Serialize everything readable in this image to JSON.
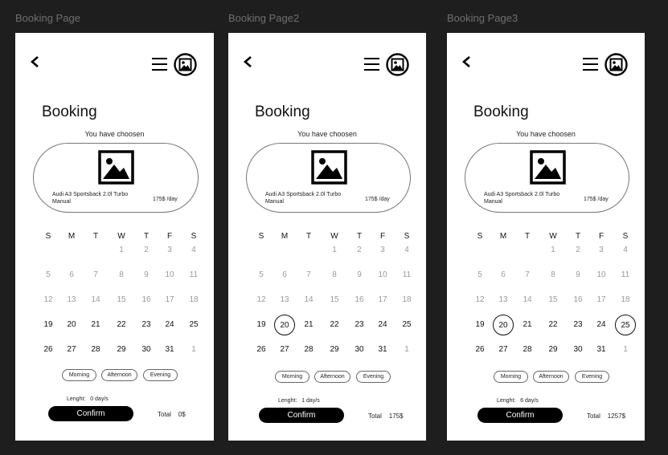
{
  "frames": [
    {
      "label": "Booking Page",
      "title": "Booking",
      "chosen_text": "You have choosen",
      "car_name_line1": "Audi A3 Sportsback 2.0l Turbo",
      "car_name_line2": "Manual",
      "car_price": "175$ /day",
      "weekdays": [
        "S",
        "M",
        "T",
        "W",
        "T",
        "F",
        "S"
      ],
      "time_options": [
        "Morning",
        "Afternoon",
        "Evening"
      ],
      "length_label": "Lenght:",
      "length_value": "0 day/s",
      "confirm_label": "Confirm",
      "total_label": "Total",
      "total_value": "0$",
      "selected_days": []
    },
    {
      "label": "Booking Page2",
      "title": "Booking",
      "chosen_text": "You have choosen",
      "car_name_line1": "Audi A3 Sportsback 2.0l Turbo",
      "car_name_line2": "Manual",
      "car_price": "175$ /day",
      "weekdays": [
        "S",
        "M",
        "T",
        "W",
        "T",
        "F",
        "S"
      ],
      "time_options": [
        "Morning",
        "Afternoon",
        "Evening"
      ],
      "length_label": "Lenght:",
      "length_value": "1 day/s",
      "confirm_label": "Confirm",
      "total_label": "Total",
      "total_value": "175$",
      "selected_days": [
        "20"
      ]
    },
    {
      "label": "Booking Page3",
      "title": "Booking",
      "chosen_text": "You have choosen",
      "car_name_line1": "Audi A3 Sportsback 2.0l Turbo",
      "car_name_line2": "Manual",
      "car_price": "175$ /day",
      "weekdays": [
        "S",
        "M",
        "T",
        "W",
        "T",
        "F",
        "S"
      ],
      "time_options": [
        "Morning",
        "Afternoon",
        "Evening"
      ],
      "length_label": "Lenght:",
      "length_value": "6 day/s",
      "confirm_label": "Confirm",
      "total_label": "Total",
      "total_value": "1257$",
      "selected_days": [
        "20",
        "25"
      ]
    }
  ],
  "calendar_rows": [
    [
      "",
      "",
      "",
      "1",
      "2",
      "3",
      "4"
    ],
    [
      "5",
      "6",
      "7",
      "8",
      "9",
      "10",
      "11"
    ],
    [
      "12",
      "13",
      "14",
      "15",
      "16",
      "17",
      "18"
    ],
    [
      "19",
      "20",
      "21",
      "22",
      "23",
      "24",
      "25"
    ],
    [
      "26",
      "27",
      "28",
      "29",
      "30",
      "31",
      "1"
    ]
  ],
  "colors": {
    "canvas": "#1e1e1e",
    "frame": "#ffffff",
    "confirm_bg": "#000000",
    "muted_day": "#9a9a9a"
  }
}
